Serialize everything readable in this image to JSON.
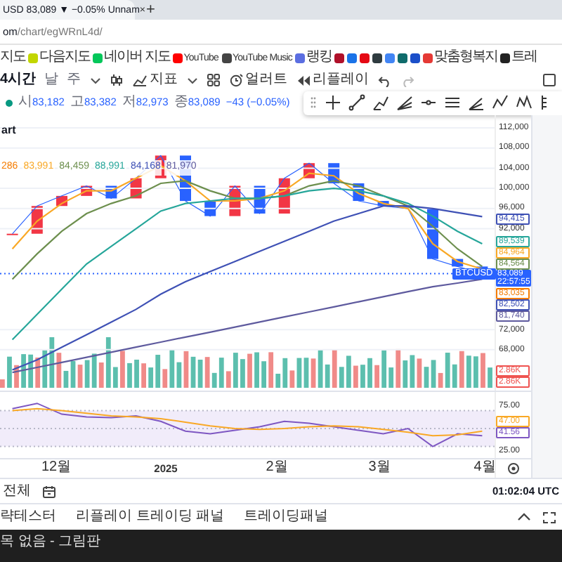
{
  "browser": {
    "tab_title": "USD 83,089 ▼ −0.05% Unnam",
    "tab_close": "×",
    "new_tab": "+",
    "address_host": "om",
    "address_path": "/chart/egWRnL4d/"
  },
  "bookmarks": [
    {
      "kind": "text",
      "label": "지도"
    },
    {
      "kind": "labeled",
      "label": "다음지도",
      "color": "#c2d600"
    },
    {
      "kind": "labeled",
      "label": "네이버 지도",
      "color": "#03c75a"
    },
    {
      "kind": "labeled",
      "label": "YouTube",
      "color": "#ff0000"
    },
    {
      "kind": "labeled",
      "label": "YouTube Music",
      "color": "#444444"
    },
    {
      "kind": "labeled",
      "label": "랭킹",
      "color": "#5b6ee1"
    },
    {
      "kind": "icon",
      "color": "#b0102a"
    },
    {
      "kind": "icon",
      "color": "#1a73e8"
    },
    {
      "kind": "icon",
      "color": "#e50914"
    },
    {
      "kind": "icon",
      "color": "#2f3b40"
    },
    {
      "kind": "icon",
      "color": "#4285f4"
    },
    {
      "kind": "icon",
      "color": "#0f6b6b"
    },
    {
      "kind": "icon",
      "color": "#1b4fc9"
    },
    {
      "kind": "labeled",
      "label": "맞춤형복지",
      "color": "#e53935"
    },
    {
      "kind": "labeled",
      "label": "트레",
      "color": "#222222"
    }
  ],
  "toolbar": {
    "intervals": [
      {
        "label": "4시간",
        "selected": true
      },
      {
        "label": "날",
        "selected": false
      },
      {
        "label": "주",
        "selected": false
      }
    ],
    "indicators": "지표",
    "alert": "얼러트",
    "replay": "리플레이"
  },
  "legend": {
    "ohlc": [
      {
        "label": "시",
        "value": "83,182"
      },
      {
        "label": "고",
        "value": "83,382"
      },
      {
        "label": "저",
        "value": "82,973"
      },
      {
        "label": "종",
        "value": "83,089"
      }
    ],
    "change": "−43 (−0.05%)"
  },
  "chart_title": "art",
  "ma_values": [
    {
      "value": "286",
      "color": "#f57c00"
    },
    {
      "value": "83,991",
      "color": "#f9a825"
    },
    {
      "value": "84,459",
      "color": "#6d8f4e"
    },
    {
      "value": "88,991",
      "color": "#26a69a"
    },
    {
      "value": "84,168",
      "color": "#3f51b5"
    },
    {
      "value": "81,970",
      "color": "#5e5a9e"
    }
  ],
  "price_chart": {
    "chart_data": {
      "type": "line",
      "grid": true,
      "ylim": [
        59900,
        114500
      ],
      "yticks": [
        {
          "value": 112000,
          "label": "112,000"
        },
        {
          "value": 108000,
          "label": "108,000"
        },
        {
          "value": 104000,
          "label": "104,000"
        },
        {
          "value": 100000,
          "label": "100,000"
        },
        {
          "value": 96000,
          "label": "96,000"
        },
        {
          "value": 92000,
          "label": "92,000"
        },
        {
          "value": 72000,
          "label": "72,000"
        },
        {
          "value": 68000,
          "label": "68,000"
        }
      ],
      "series": [
        {
          "name": "BTCUSD",
          "color": "#2962ff",
          "values": [
            91000,
            96500,
            98500,
            100500,
            98000,
            102000,
            106500,
            97500,
            94500,
            100500,
            95000,
            102000,
            105000,
            101000,
            97500,
            96500,
            96000,
            86000,
            84500,
            83100
          ]
        },
        {
          "color": "#f9a825",
          "values": [
            88000,
            93500,
            97000,
            99500,
            99500,
            102000,
            104500,
            101500,
            97500,
            97500,
            98000,
            99500,
            103000,
            102500,
            99000,
            97000,
            96000,
            89000,
            85500,
            84000
          ]
        },
        {
          "color": "#6d8f4e",
          "values": [
            82000,
            87000,
            91500,
            95000,
            97000,
            98500,
            101000,
            101500,
            99500,
            98000,
            98000,
            98500,
            100500,
            101500,
            100500,
            98500,
            96500,
            92500,
            88000,
            84500
          ]
        },
        {
          "color": "#26a69a",
          "values": [
            70000,
            75000,
            80000,
            85000,
            88500,
            92000,
            95500,
            97000,
            97500,
            98000,
            98000,
            98500,
            99500,
            100000,
            99500,
            98500,
            97000,
            94500,
            91500,
            89000
          ]
        },
        {
          "color": "#3f51b5",
          "values": [
            64000,
            66000,
            68500,
            71000,
            73500,
            76000,
            79000,
            81500,
            83500,
            85500,
            87500,
            89500,
            91500,
            93500,
            95000,
            96500,
            96500,
            96000,
            95200,
            94400
          ]
        },
        {
          "color": "#5e5a9e",
          "values": [
            63500,
            64500,
            65500,
            66500,
            67500,
            68500,
            69500,
            70500,
            71500,
            72500,
            73500,
            74500,
            75500,
            76500,
            77500,
            78500,
            79500,
            80500,
            81200,
            82000
          ]
        }
      ]
    }
  },
  "price_tags": [
    {
      "label": "94,415",
      "color": "#3f51b5"
    },
    {
      "label": "89,539",
      "color": "#26a69a"
    },
    {
      "label": "84,964",
      "color": "#f9a825"
    },
    {
      "label": "84,564",
      "color": "#6d8f4e"
    }
  ],
  "current_price": {
    "price": "83,089",
    "countdown": "22:57:55"
  },
  "price_tags_below": [
    {
      "label": "83,035",
      "color": "#f57c00"
    },
    {
      "label": "82,502",
      "color": "#3f51b5"
    },
    {
      "label": "81,740",
      "color": "#5e5a9e"
    }
  ],
  "volume_tags": [
    "2.86K",
    "2.86K"
  ],
  "rsi": {
    "chart_data": {
      "type": "line",
      "ylim": [
        17.2,
        90.6
      ],
      "yticks": [
        {
          "value": 75,
          "label": "75.00"
        },
        {
          "value": 25,
          "label": "25.00"
        }
      ],
      "series": [
        {
          "color": "#7e57c2",
          "values": [
            72,
            78,
            66,
            63,
            62,
            64,
            58,
            47,
            44,
            48,
            52,
            58,
            56,
            52,
            48,
            44,
            50,
            30,
            44,
            42
          ]
        },
        {
          "color": "#f9a825",
          "values": [
            70,
            72,
            70,
            67,
            64,
            63,
            61,
            57,
            53,
            50,
            49,
            50,
            52,
            53,
            52,
            49,
            46,
            42,
            43,
            47
          ]
        }
      ]
    },
    "tags": [
      {
        "label": "47.00",
        "color": "#f9a825"
      },
      {
        "label": "41.56",
        "color": "#7e57c2"
      }
    ]
  },
  "time_axis": [
    {
      "label": "12월",
      "kind": "month"
    },
    {
      "label": "2025",
      "kind": "year"
    },
    {
      "label": "2월",
      "kind": "month"
    },
    {
      "label": "3월",
      "kind": "month"
    },
    {
      "label": "4월",
      "kind": "month"
    }
  ],
  "bottom_bar": {
    "range": "전체",
    "clock": "01:02:04 UTC"
  },
  "panels": [
    {
      "label": "략테스터"
    },
    {
      "label": "리플레이 트레이딩 패널"
    },
    {
      "label": "트레이딩패널"
    }
  ],
  "taskbar": {
    "window_title": "목 없음 - 그림판"
  }
}
